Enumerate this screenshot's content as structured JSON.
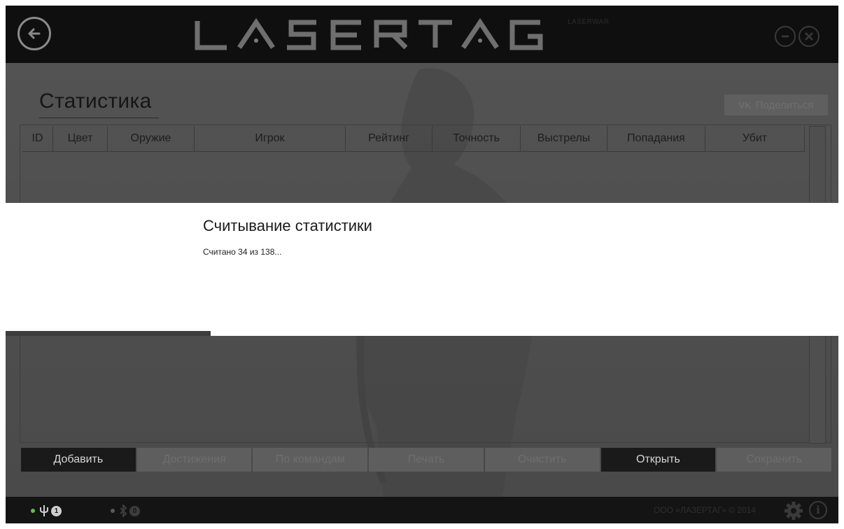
{
  "titlebar": {
    "logo_text": "LASERTAG",
    "logo_sub": "LASERWAR"
  },
  "page": {
    "title": "Статистика",
    "share_label": "Поделиться",
    "share_icon": "vk-icon",
    "vk_text": "VK"
  },
  "table": {
    "columns": [
      "ID",
      "Цвет",
      "Оружие",
      "Игрок",
      "Рейтинг",
      "Точность",
      "Выстрелы",
      "Попадания",
      "Убит"
    ],
    "rows": []
  },
  "actions": [
    {
      "label": "Добавить",
      "state": "enabled"
    },
    {
      "label": "Достижения",
      "state": "disabled"
    },
    {
      "label": "По командам",
      "state": "disabled"
    },
    {
      "label": "Печать",
      "state": "disabled"
    },
    {
      "label": "Очистить",
      "state": "disabled"
    },
    {
      "label": "Открыть",
      "state": "enabled"
    },
    {
      "label": "Сохранить",
      "state": "disabled"
    }
  ],
  "modal": {
    "title": "Считывание статистики",
    "status": "Считано 34 из 138...",
    "progress_done": 34,
    "progress_total": 138
  },
  "statusbar": {
    "usb_count": "1",
    "bt_count": "0",
    "copyright": "ООО «ЛАЗЕРТАГ» © 2014"
  },
  "colors": {
    "usb_dot": "#5fc24a",
    "bt_dot": "#5a5a5a",
    "active_button_bg": "#1a1a1a",
    "disabled_button_bg": "#5e5e5e"
  }
}
